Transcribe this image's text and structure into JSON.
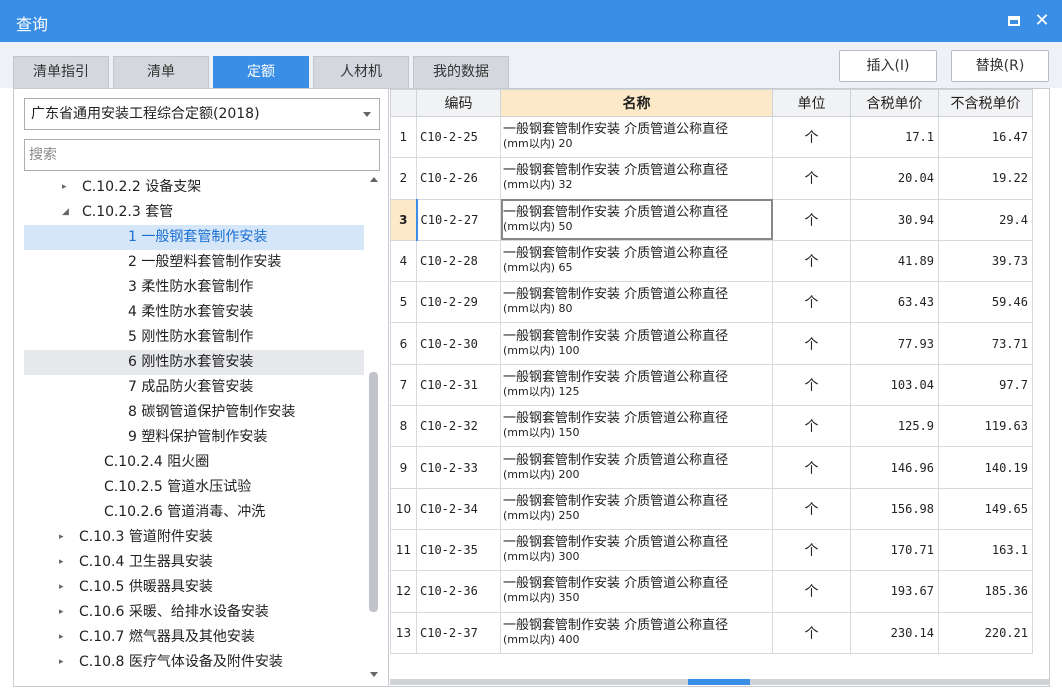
{
  "window": {
    "title": "查询"
  },
  "tabs": [
    {
      "label": "清单指引",
      "active": false
    },
    {
      "label": "清单",
      "active": false
    },
    {
      "label": "定额",
      "active": true
    },
    {
      "label": "人材机",
      "active": false
    },
    {
      "label": "我的数据",
      "active": false
    }
  ],
  "actions": {
    "insert_label": "插入(I)",
    "replace_label": "替换(R)"
  },
  "left": {
    "library": "广东省通用安装工程综合定额(2018)",
    "search_placeholder": "搜索",
    "tree": [
      {
        "label": "C.10.2.2 设备支架",
        "toggle": "▸"
      },
      {
        "label": "C.10.2.3 套管",
        "toggle": "◢"
      },
      {
        "label": "1 一般钢套管制作安装",
        "toggle": "",
        "selected": true
      },
      {
        "label": "2 一般塑料套管制作安装",
        "toggle": ""
      },
      {
        "label": "3 柔性防水套管制作",
        "toggle": ""
      },
      {
        "label": "4 柔性防水套管安装",
        "toggle": ""
      },
      {
        "label": "5 刚性防水套管制作",
        "toggle": ""
      },
      {
        "label": "6 刚性防水套管安装",
        "toggle": "",
        "hover": true
      },
      {
        "label": "7 成品防火套管安装",
        "toggle": ""
      },
      {
        "label": "8 碳钢管道保护管制作安装",
        "toggle": ""
      },
      {
        "label": "9 塑料保护管制作安装",
        "toggle": ""
      },
      {
        "label": "C.10.2.4 阻火圈",
        "toggle": ""
      },
      {
        "label": "C.10.2.5 管道水压试验",
        "toggle": ""
      },
      {
        "label": "C.10.2.6 管道消毒、冲洗",
        "toggle": ""
      },
      {
        "label": "C.10.3 管道附件安装",
        "toggle": "▸"
      },
      {
        "label": "C.10.4 卫生器具安装",
        "toggle": "▸"
      },
      {
        "label": "C.10.5 供暖器具安装",
        "toggle": "▸"
      },
      {
        "label": "C.10.6 采暖、给排水设备安装",
        "toggle": "▸"
      },
      {
        "label": "C.10.7 燃气器具及其他安装",
        "toggle": "▸"
      },
      {
        "label": "C.10.8 医疗气体设备及附件安装",
        "toggle": "▸"
      }
    ]
  },
  "table": {
    "headers": {
      "code": "编码",
      "name": "名称",
      "unit": "单位",
      "price_tax": "含税单价",
      "price_notax": "不含税单价"
    },
    "rows": [
      {
        "n": "1",
        "code": "C10-2-25",
        "name": "一般钢套管制作安装 介质管道公称直径",
        "sub": "(mm以内) 20",
        "unit": "个",
        "p1": "17.1",
        "p2": "16.47"
      },
      {
        "n": "2",
        "code": "C10-2-26",
        "name": "一般钢套管制作安装 介质管道公称直径",
        "sub": "(mm以内) 32",
        "unit": "个",
        "p1": "20.04",
        "p2": "19.22"
      },
      {
        "n": "3",
        "code": "C10-2-27",
        "name": "一般钢套管制作安装 介质管道公称直径",
        "sub": "(mm以内) 50",
        "unit": "个",
        "p1": "30.94",
        "p2": "29.4",
        "active": true
      },
      {
        "n": "4",
        "code": "C10-2-28",
        "name": "一般钢套管制作安装 介质管道公称直径",
        "sub": "(mm以内) 65",
        "unit": "个",
        "p1": "41.89",
        "p2": "39.73"
      },
      {
        "n": "5",
        "code": "C10-2-29",
        "name": "一般钢套管制作安装 介质管道公称直径",
        "sub": "(mm以内) 80",
        "unit": "个",
        "p1": "63.43",
        "p2": "59.46"
      },
      {
        "n": "6",
        "code": "C10-2-30",
        "name": "一般钢套管制作安装 介质管道公称直径",
        "sub": "(mm以内) 100",
        "unit": "个",
        "p1": "77.93",
        "p2": "73.71"
      },
      {
        "n": "7",
        "code": "C10-2-31",
        "name": "一般钢套管制作安装 介质管道公称直径",
        "sub": "(mm以内) 125",
        "unit": "个",
        "p1": "103.04",
        "p2": "97.7"
      },
      {
        "n": "8",
        "code": "C10-2-32",
        "name": "一般钢套管制作安装 介质管道公称直径",
        "sub": "(mm以内) 150",
        "unit": "个",
        "p1": "125.9",
        "p2": "119.63"
      },
      {
        "n": "9",
        "code": "C10-2-33",
        "name": "一般钢套管制作安装 介质管道公称直径",
        "sub": "(mm以内) 200",
        "unit": "个",
        "p1": "146.96",
        "p2": "140.19"
      },
      {
        "n": "10",
        "code": "C10-2-34",
        "name": "一般钢套管制作安装 介质管道公称直径",
        "sub": "(mm以内) 250",
        "unit": "个",
        "p1": "156.98",
        "p2": "149.65"
      },
      {
        "n": "11",
        "code": "C10-2-35",
        "name": "一般钢套管制作安装 介质管道公称直径",
        "sub": "(mm以内) 300",
        "unit": "个",
        "p1": "170.71",
        "p2": "163.1"
      },
      {
        "n": "12",
        "code": "C10-2-36",
        "name": "一般钢套管制作安装 介质管道公称直径",
        "sub": "(mm以内) 350",
        "unit": "个",
        "p1": "193.67",
        "p2": "185.36"
      },
      {
        "n": "13",
        "code": "C10-2-37",
        "name": "一般钢套管制作安装 介质管道公称直径",
        "sub": "(mm以内) 400",
        "unit": "个",
        "p1": "230.14",
        "p2": "220.21"
      }
    ]
  }
}
